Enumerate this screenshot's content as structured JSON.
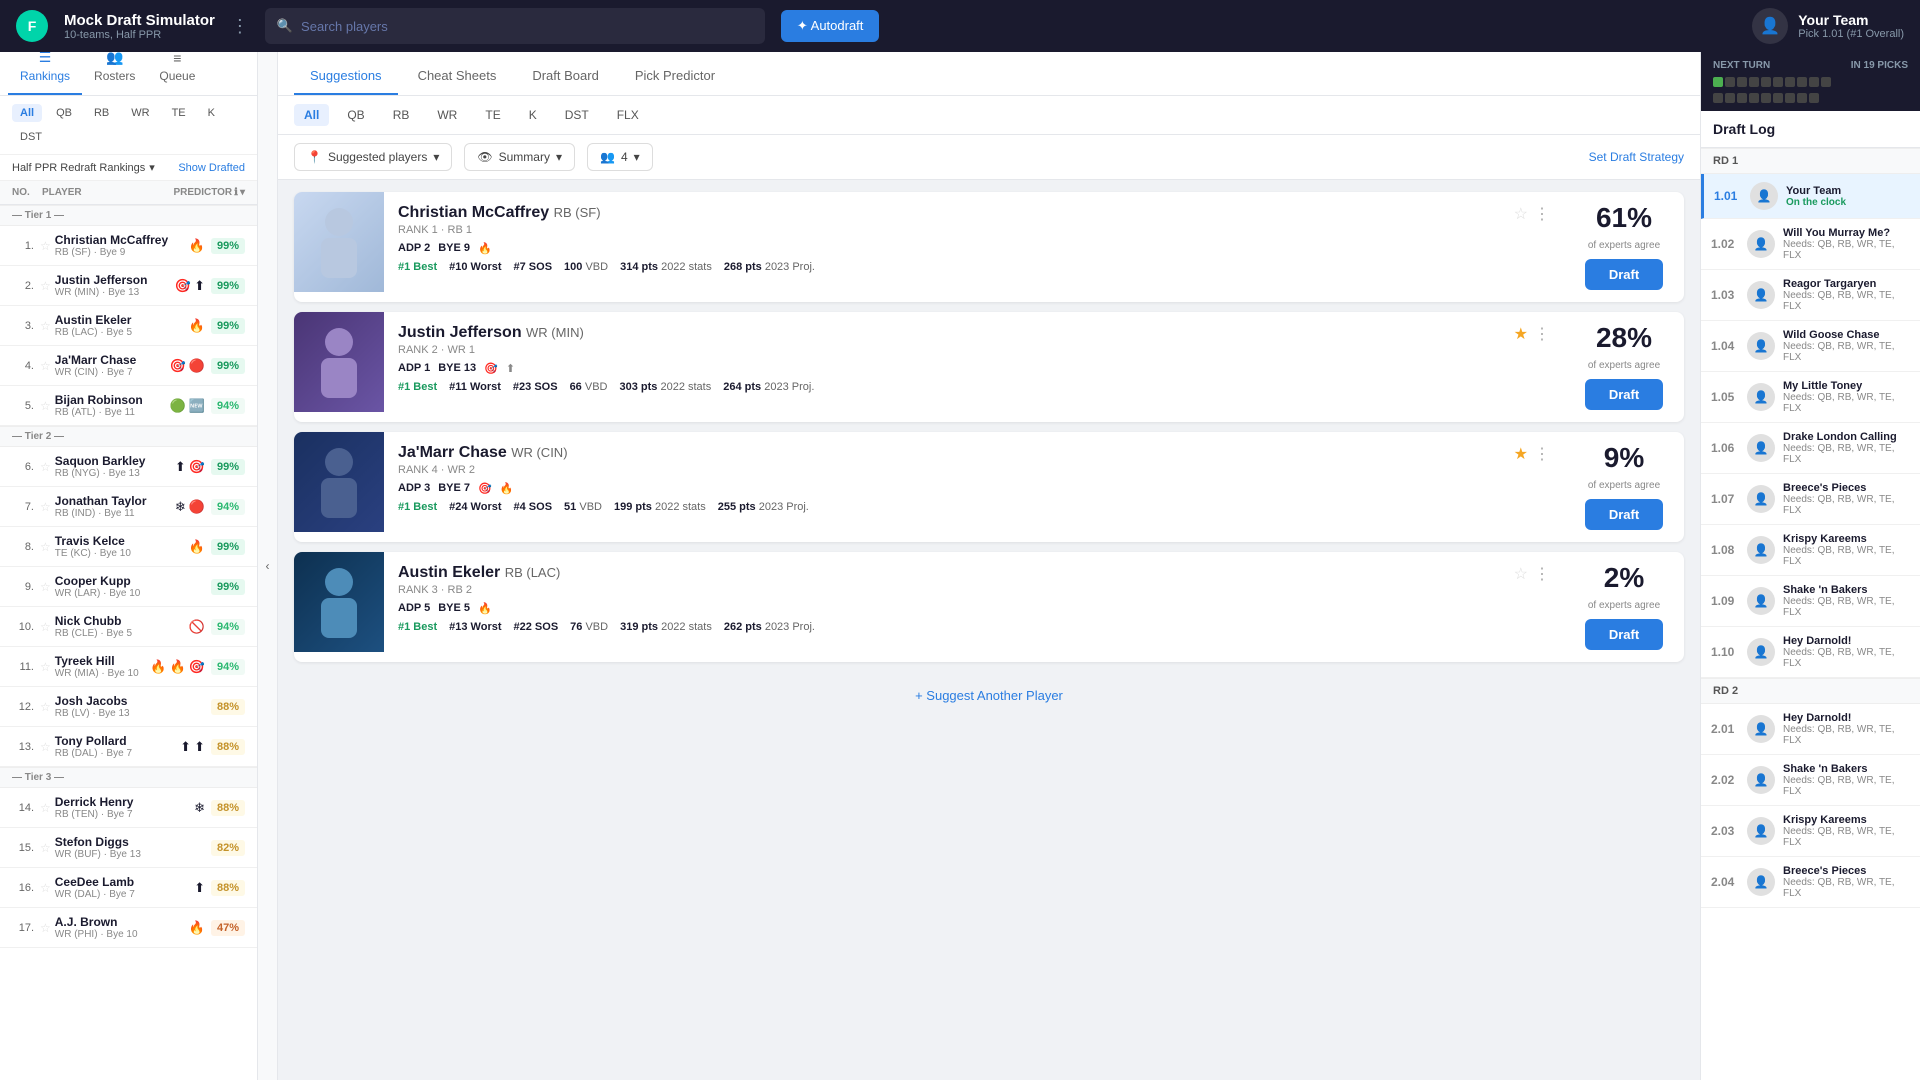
{
  "header": {
    "logo_text": "F",
    "app_title": "Mock Draft Simulator",
    "app_subtitle": "10-teams, Half PPR",
    "search_placeholder": "Search players",
    "autodraft_label": "✦ Autodraft",
    "team_name": "Your Team",
    "team_pick": "Pick 1.01 (#1 Overall)"
  },
  "left_nav": {
    "items": [
      {
        "label": "Rankings",
        "icon": "☰",
        "active": true
      },
      {
        "label": "Rosters",
        "icon": "👥",
        "active": false
      },
      {
        "label": "Queue",
        "icon": "≡",
        "active": false
      }
    ]
  },
  "filters": {
    "position_chips": [
      "All",
      "QB",
      "RB",
      "WR",
      "TE",
      "K",
      "DST"
    ],
    "active_chip": "All"
  },
  "ranking_dropdown": "Half PPR Redraft Rankings",
  "show_drafted": "Show Drafted",
  "table_headers": {
    "no": "NO.",
    "player": "PLAYER",
    "predictor": "PREDICTOR"
  },
  "tiers": [
    {
      "label": "Tier 1",
      "players": [
        {
          "no": 1,
          "name": "Christian McCaffrey",
          "meta": "RB (SF) · Bye 9",
          "badge": "99%",
          "badge_class": "badge-green",
          "star": false,
          "icons": [
            "🔥"
          ]
        },
        {
          "no": 2,
          "name": "Justin Jefferson",
          "meta": "WR (MIN) · Bye 13",
          "badge": "99%",
          "badge_class": "badge-green",
          "star": false,
          "icons": [
            "🎯",
            "⬆"
          ]
        },
        {
          "no": 3,
          "name": "Austin Ekeler",
          "meta": "RB (LAC) · Bye 5",
          "badge": "99%",
          "badge_class": "badge-green",
          "star": false,
          "icons": [
            "🔥"
          ]
        },
        {
          "no": 4,
          "name": "Ja'Marr Chase",
          "meta": "WR (CIN) · Bye 7",
          "badge": "99%",
          "badge_class": "badge-green",
          "star": false,
          "icons": [
            "🎯",
            "🔴"
          ]
        },
        {
          "no": 5,
          "name": "Bijan Robinson",
          "meta": "RB (ATL) · Bye 11",
          "badge": "94%",
          "badge_class": "badge-light-green",
          "star": false,
          "icons": [
            "🟢",
            "🆕"
          ]
        }
      ]
    },
    {
      "label": "Tier 2",
      "players": [
        {
          "no": 6,
          "name": "Saquon Barkley",
          "meta": "RB (NYG) · Bye 13",
          "badge": "99%",
          "badge_class": "badge-green",
          "star": false,
          "icons": [
            "⬆",
            "🎯"
          ]
        },
        {
          "no": 7,
          "name": "Jonathan Taylor",
          "meta": "RB (IND) · Bye 11",
          "badge": "94%",
          "badge_class": "badge-light-green",
          "star": false,
          "icons": [
            "❄",
            "🔴"
          ]
        },
        {
          "no": 8,
          "name": "Travis Kelce",
          "meta": "TE (KC) · Bye 10",
          "badge": "99%",
          "badge_class": "badge-green",
          "star": false,
          "icons": [
            "🔥"
          ]
        },
        {
          "no": 9,
          "name": "Cooper Kupp",
          "meta": "WR (LAR) · Bye 10",
          "badge": "99%",
          "badge_class": "badge-green",
          "star": false,
          "icons": []
        },
        {
          "no": 10,
          "name": "Nick Chubb",
          "meta": "RB (CLE) · Bye 5",
          "badge": "94%",
          "badge_class": "badge-light-green",
          "star": false,
          "icons": [
            "🚫"
          ]
        },
        {
          "no": 11,
          "name": "Tyreek Hill",
          "meta": "WR (MIA) · Bye 10",
          "badge": "94%",
          "badge_class": "badge-light-green",
          "star": false,
          "icons": [
            "🔥",
            "🔥",
            "🎯"
          ]
        },
        {
          "no": 12,
          "name": "Josh Jacobs",
          "meta": "RB (LV) · Bye 13",
          "badge": "88%",
          "badge_class": "badge-yellow",
          "star": false,
          "icons": []
        },
        {
          "no": 13,
          "name": "Tony Pollard",
          "meta": "RB (DAL) · Bye 7",
          "badge": "88%",
          "badge_class": "badge-yellow",
          "star": false,
          "icons": [
            "⬆",
            "⬆"
          ]
        }
      ]
    },
    {
      "label": "Tier 3",
      "players": [
        {
          "no": 14,
          "name": "Derrick Henry",
          "meta": "RB (TEN) · Bye 7",
          "badge": "88%",
          "badge_class": "badge-yellow",
          "star": false,
          "icons": [
            "❄"
          ]
        },
        {
          "no": 15,
          "name": "Stefon Diggs",
          "meta": "WR (BUF) · Bye 13",
          "badge": "82%",
          "badge_class": "badge-yellow",
          "star": false,
          "icons": []
        },
        {
          "no": 16,
          "name": "CeeDee Lamb",
          "meta": "WR (DAL) · Bye 7",
          "badge": "88%",
          "badge_class": "badge-yellow",
          "star": false,
          "icons": [
            "⬆"
          ]
        },
        {
          "no": 17,
          "name": "A.J. Brown",
          "meta": "WR (PHI) · Bye 10",
          "badge": "47%",
          "badge_class": "badge-orange",
          "star": false,
          "icons": [
            "🔥"
          ]
        }
      ]
    }
  ],
  "main_tabs": [
    "Suggestions",
    "Cheat Sheets",
    "Draft Board",
    "Pick Predictor"
  ],
  "active_main_tab": "Suggestions",
  "position_filters": [
    "All",
    "QB",
    "RB",
    "WR",
    "TE",
    "K",
    "DST",
    "FLX"
  ],
  "active_pos_filter": "All",
  "controls": {
    "suggested_players_label": "Suggested players",
    "summary_label": "Summary",
    "count_label": "4",
    "set_strategy": "Set Draft Strategy"
  },
  "player_cards": [
    {
      "name": "Christian McCaffrey",
      "position_team": "RB (SF)",
      "rank_label": "RANK 1 · RB 1",
      "adp": "ADP 2",
      "bye": "BYE 9",
      "best": "#1 Best",
      "worst": "#10 Worst",
      "sos": "#7 SOS",
      "vbd": "100 VBD",
      "stats_2022": "314 pts",
      "proj_2023": "268 pts",
      "experts_pct": "61%",
      "experts_label": "of experts agree",
      "star": false,
      "icons": [
        "🔥"
      ]
    },
    {
      "name": "Justin Jefferson",
      "position_team": "WR (MIN)",
      "rank_label": "RANK 2 · WR 1",
      "adp": "ADP 1",
      "bye": "BYE 13",
      "best": "#1 Best",
      "worst": "#11 Worst",
      "sos": "#23 SOS",
      "vbd": "66 VBD",
      "stats_2022": "303 pts",
      "proj_2023": "264 pts",
      "experts_pct": "28%",
      "experts_label": "of experts agree",
      "star": true,
      "icons": [
        "🎯",
        "⬆"
      ]
    },
    {
      "name": "Ja'Marr Chase",
      "position_team": "WR (CIN)",
      "rank_label": "RANK 4 · WR 2",
      "adp": "ADP 3",
      "bye": "BYE 7",
      "best": "#1 Best",
      "worst": "#24 Worst",
      "sos": "#4 SOS",
      "vbd": "51 VBD",
      "stats_2022": "199 pts",
      "proj_2023": "255 pts",
      "experts_pct": "9%",
      "experts_label": "of experts agree",
      "star": true,
      "icons": [
        "🎯",
        "🔥"
      ]
    },
    {
      "name": "Austin Ekeler",
      "position_team": "RB (LAC)",
      "rank_label": "RANK 3 · RB 2",
      "adp": "ADP 5",
      "bye": "BYE 5",
      "best": "#1 Best",
      "worst": "#13 Worst",
      "sos": "#22 SOS",
      "vbd": "76 VBD",
      "stats_2022": "319 pts",
      "proj_2023": "262 pts",
      "experts_pct": "2%",
      "experts_label": "of experts agree",
      "star": false,
      "icons": [
        "🔥"
      ]
    }
  ],
  "suggest_another": "+ Suggest Another Player",
  "right_panel": {
    "next_turn_label": "NEXT TURN",
    "in_picks_label": "IN 19 PICKS",
    "draft_log_title": "Draft Log",
    "rd1_label": "RD 1",
    "rd2_label": "RD 2",
    "picks_rd1": [
      {
        "pick": "1.01",
        "team": "Your Team",
        "needs": "On the clock",
        "active": true
      },
      {
        "pick": "1.02",
        "team": "Will You Murray Me?",
        "needs": "Needs: QB, RB, WR, TE, FLX",
        "active": false
      },
      {
        "pick": "1.03",
        "team": "Reagor Targaryen",
        "needs": "Needs: QB, RB, WR, TE, FLX",
        "active": false
      },
      {
        "pick": "1.04",
        "team": "Wild Goose Chase",
        "needs": "Needs: QB, RB, WR, TE, FLX",
        "active": false
      },
      {
        "pick": "1.05",
        "team": "My Little Toney",
        "needs": "Needs: QB, RB, WR, TE, FLX",
        "active": false
      },
      {
        "pick": "1.06",
        "team": "Drake London Calling",
        "needs": "Needs: QB, RB, WR, TE, FLX",
        "active": false
      },
      {
        "pick": "1.07",
        "team": "Breece's Pieces",
        "needs": "Needs: QB, RB, WR, TE, FLX",
        "active": false
      },
      {
        "pick": "1.08",
        "team": "Krispy Kareems",
        "needs": "Needs: QB, RB, WR, TE, FLX",
        "active": false
      },
      {
        "pick": "1.09",
        "team": "Shake 'n Bakers",
        "needs": "Needs: QB, RB, WR, TE, FLX",
        "active": false
      },
      {
        "pick": "1.10",
        "team": "Hey Darnold!",
        "needs": "Needs: QB, RB, WR, TE, FLX",
        "active": false
      }
    ],
    "picks_rd2": [
      {
        "pick": "2.01",
        "team": "Hey Darnold!",
        "needs": "Needs: QB, RB, WR, TE, FLX",
        "active": false
      },
      {
        "pick": "2.02",
        "team": "Shake 'n Bakers",
        "needs": "Needs: QB, RB, WR, TE, FLX",
        "active": false
      },
      {
        "pick": "2.03",
        "team": "Krispy Kareems",
        "needs": "Needs: QB, RB, WR, TE, FLX",
        "active": false
      },
      {
        "pick": "2.04",
        "team": "Breece's Pieces",
        "needs": "Needs: QB, RB, WR, TE, FLX",
        "active": false
      }
    ]
  }
}
